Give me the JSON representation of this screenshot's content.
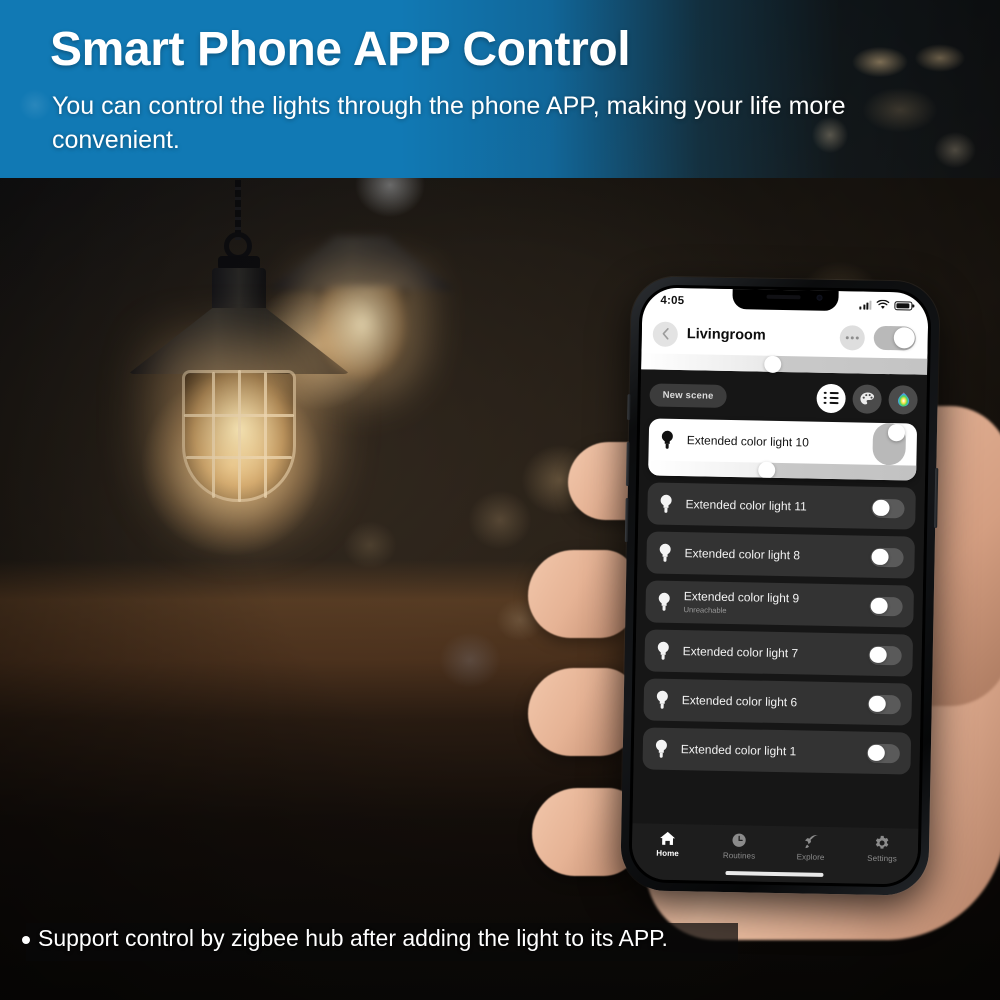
{
  "banner": {
    "title": "Smart Phone APP Control",
    "subtitle": "You can control the lights through the phone APP, making your life more convenient.",
    "bg_color_left": "#1179b4"
  },
  "caption": {
    "bullet_text": "Support control by zigbee hub after adding the light to its APP."
  },
  "phone": {
    "status_bar": {
      "time": "4:05",
      "signal_icon": "signal-bars-icon",
      "wifi_icon": "wifi-icon",
      "battery_icon": "battery-icon"
    },
    "header": {
      "back_icon": "chevron-left-icon",
      "title": "Livingroom",
      "overflow_icon": "more-dots-icon",
      "master_toggle_state": "on",
      "brightness_percent": 45
    },
    "scene_row": {
      "new_scene_label": "New scene",
      "actions": [
        {
          "name": "list-view-icon",
          "active": true
        },
        {
          "name": "palette-icon",
          "active": false
        },
        {
          "name": "color-picker-icon",
          "active": false
        }
      ]
    },
    "lights": [
      {
        "name": "Extended color light 10",
        "status": "",
        "toggle": "on",
        "brightness_percent": 45
      },
      {
        "name": "Extended color light 11",
        "status": "",
        "toggle": "off"
      },
      {
        "name": "Extended color light 8",
        "status": "",
        "toggle": "off"
      },
      {
        "name": "Extended color light 9",
        "status": "Unreachable",
        "toggle": "off"
      },
      {
        "name": "Extended color light 7",
        "status": "",
        "toggle": "off"
      },
      {
        "name": "Extended color light 6",
        "status": "",
        "toggle": "off"
      },
      {
        "name": "Extended color light 1",
        "status": "",
        "toggle": "off"
      }
    ],
    "tabs": [
      {
        "label": "Home",
        "icon": "home-icon",
        "active": true
      },
      {
        "label": "Routines",
        "icon": "clock-icon",
        "active": false
      },
      {
        "label": "Explore",
        "icon": "rocket-icon",
        "active": false
      },
      {
        "label": "Settings",
        "icon": "gear-icon",
        "active": false
      }
    ]
  }
}
